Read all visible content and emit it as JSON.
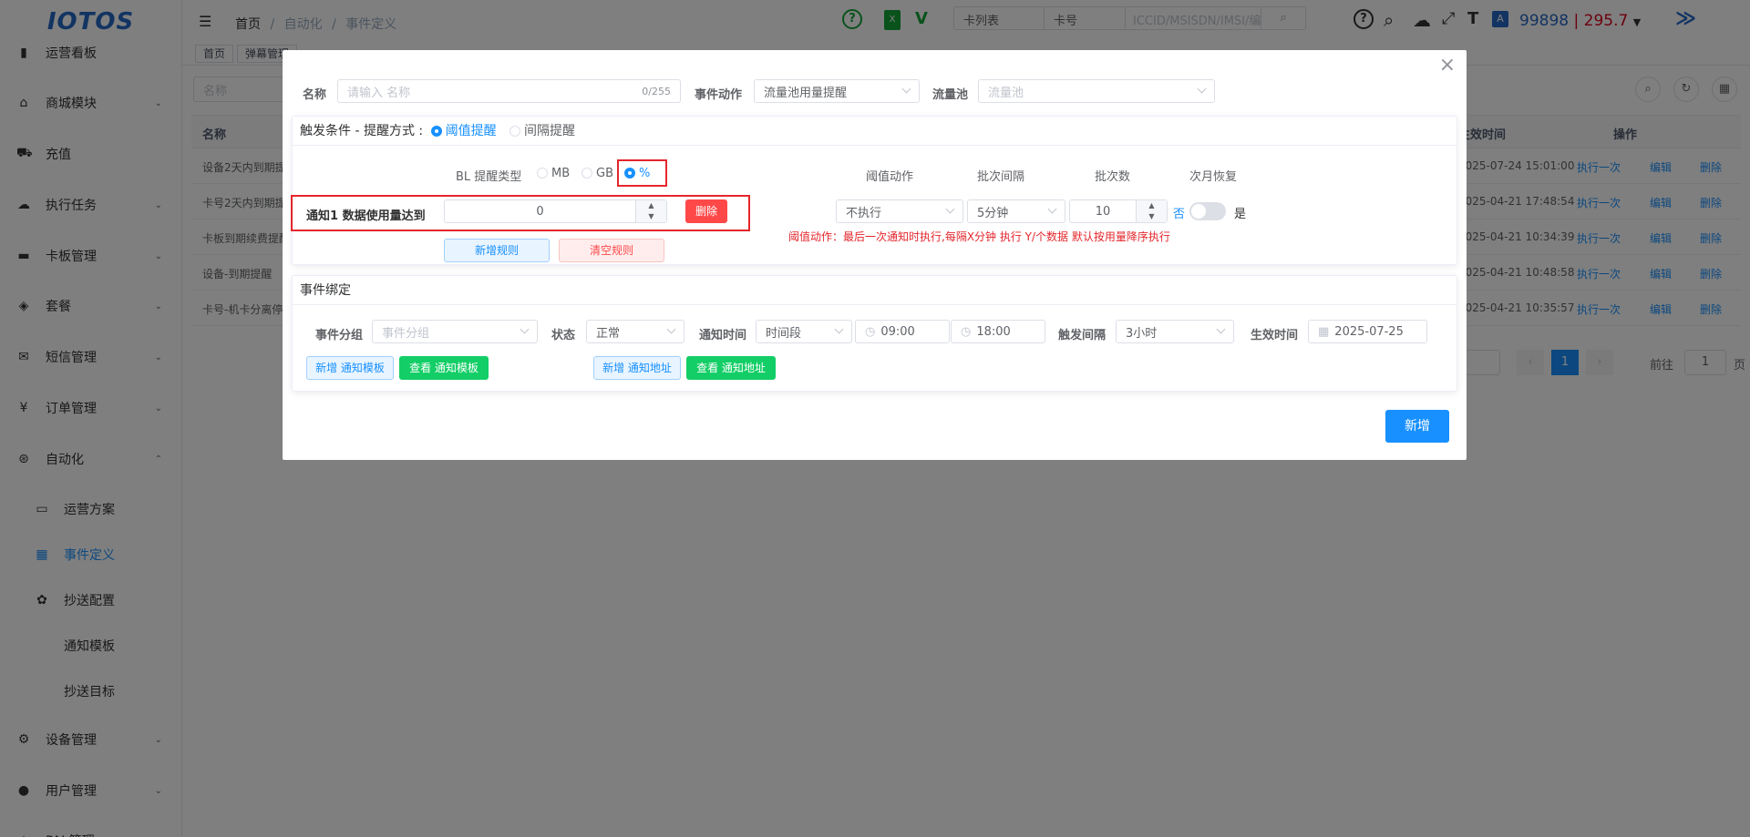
{
  "sidebar": {
    "logo": "IOTOS",
    "items": [
      {
        "label": "运营看板",
        "icon": "bar-chart-icon",
        "glyph": "▮"
      },
      {
        "label": "商城模块",
        "icon": "shop-icon",
        "glyph": "⌂"
      },
      {
        "label": "充值",
        "icon": "cart-icon",
        "glyph": "⛟"
      },
      {
        "label": "执行任务",
        "icon": "cloud-icon",
        "glyph": "☁"
      },
      {
        "label": "卡板管理",
        "icon": "card-icon",
        "glyph": "▬"
      },
      {
        "label": "套餐",
        "icon": "layers-icon",
        "glyph": "◈"
      },
      {
        "label": "短信管理",
        "icon": "mail-icon",
        "glyph": "✉"
      },
      {
        "label": "订单管理",
        "icon": "yen-icon",
        "glyph": "¥"
      },
      {
        "label": "自动化",
        "icon": "automation-icon",
        "glyph": "⊛"
      },
      {
        "label": "运营方案",
        "icon": "monitor-icon",
        "glyph": "▭"
      },
      {
        "label": "事件定义",
        "icon": "event-icon",
        "glyph": "▦"
      },
      {
        "label": "抄送配置",
        "icon": "gear-icon",
        "glyph": "✿"
      },
      {
        "label": "通知模板",
        "icon": "",
        "glyph": ""
      },
      {
        "label": "抄送目标",
        "icon": "",
        "glyph": ""
      },
      {
        "label": "设备管理",
        "icon": "device-icon",
        "glyph": "⚙"
      },
      {
        "label": "用户管理",
        "icon": "user-icon",
        "glyph": "●"
      },
      {
        "label": "PAI 管理",
        "icon": "pai-icon",
        "glyph": "◆"
      }
    ]
  },
  "breadcrumb": [
    "首页",
    "自动化",
    "事件定义"
  ],
  "header": {
    "card_list": "卡列表",
    "card_no": "卡号",
    "search_placeholder": "ICCID/MSISDN/IMSI/编号",
    "balance": "99898",
    "separator": "|",
    "balance2": "295.7"
  },
  "tags": [
    "首页",
    "弹幕管理"
  ],
  "filter": {
    "name_placeholder": "名称"
  },
  "table": {
    "headers": {
      "name": "名称",
      "time": "生效时间",
      "ops": "操作"
    },
    "rows": [
      {
        "name": "设备2天内到期提",
        "time": "2025-07-24 15:01:00"
      },
      {
        "name": "卡号2天内到期提",
        "time": "2025-04-21 17:48:54"
      },
      {
        "name": "卡板到期续费提醒",
        "time": "2025-04-21 10:34:39"
      },
      {
        "name": "设备-到期提醒",
        "time": "2025-04-21 10:48:58"
      },
      {
        "name": "卡号-机卡分离停",
        "time": "2025-04-21 10:35:57"
      }
    ],
    "op_run": "执行一次",
    "op_edit": "编辑",
    "op_delete": "删除"
  },
  "pagination": {
    "page": "1",
    "goto": "前往",
    "goto_value": "1",
    "page_unit": "页"
  },
  "dialog": {
    "name_label": "名称",
    "name_placeholder": "请输入 名称",
    "name_count": "0/255",
    "action_label": "事件动作",
    "action_value": "流量池用量提醒",
    "pool_label": "流量池",
    "pool_placeholder": "流量池",
    "trigger_title": "触发条件 - 提醒方式 :",
    "mode_threshold": "阈值提醒",
    "mode_interval": "间隔提醒",
    "bl_label": "BL 提醒类型",
    "unit_mb": "MB",
    "unit_gb": "GB",
    "unit_pct": "%",
    "notify_label": "通知1 数据使用量达到",
    "notify_value": "0",
    "delete_btn": "删除",
    "add_rule": "新增规则",
    "clear_rule": "清空规则",
    "col_action": "阈值动作",
    "col_interval": "批次间隔",
    "col_count": "批次数",
    "col_next": "次月恢复",
    "action_sel": "不执行",
    "interval_sel": "5分钟",
    "count_value": "10",
    "switch_no": "否",
    "switch_yes": "是",
    "hint": "阈值动作：最后一次通知时执行,每隔X分钟 执行 Y/个数据 默认按用量降序执行",
    "bind_title": "事件绑定",
    "group_label": "事件分组",
    "group_placeholder": "事件分组",
    "status_label": "状态",
    "status_value": "正常",
    "notify_time_label": "通知时间",
    "period_value": "时间段",
    "time_start": "09:00",
    "time_end": "18:00",
    "trigger_interval_label": "触发间隔",
    "trigger_interval_value": "3小时",
    "effective_label": "生效时间",
    "effective_value": "2025-07-25",
    "add_tpl": "新增 通知模板",
    "view_tpl": "查看 通知模板",
    "add_addr": "新增 通知地址",
    "view_addr": "查看 通知地址",
    "submit": "新增",
    "close": "×"
  },
  "colors": {
    "primary": "#1890ff",
    "danger": "#ff4949",
    "success": "#13ce66",
    "balance_red": "#d9001b"
  }
}
